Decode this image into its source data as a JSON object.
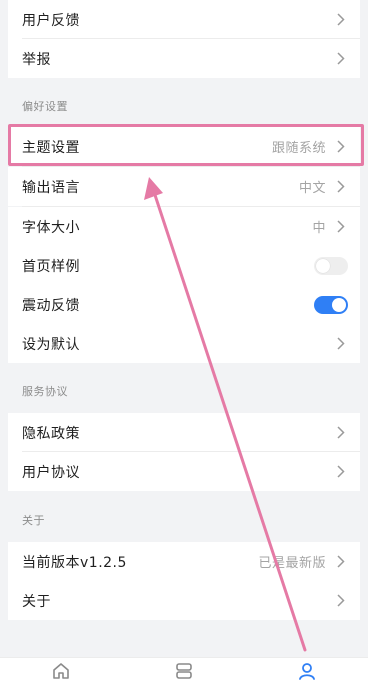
{
  "colors": {
    "background": "#f2f3f5",
    "card": "#ffffff",
    "toggle_on": "#2f7ff5",
    "highlight": "#e57aa5"
  },
  "rows": {
    "feedback": "用户反馈",
    "report": "举报",
    "theme": {
      "label": "主题设置",
      "value": "跟随系统"
    },
    "language": {
      "label": "输出语言",
      "value": "中文"
    },
    "font_size": {
      "label": "字体大小",
      "value": "中"
    },
    "home_style": {
      "label": "首页样例",
      "toggle": false
    },
    "vibration": {
      "label": "震动反馈",
      "toggle": true
    },
    "set_default": "设为默认",
    "privacy": "隐私政策",
    "user_agreement": "用户协议",
    "version": {
      "label": "当前版本v1.2.5",
      "value": "已是最新版"
    },
    "about": "关于"
  },
  "sections": {
    "preferences": "偏好设置",
    "service": "服务协议",
    "about": "关于"
  },
  "tabbar": {
    "tabs": [
      {
        "icon": "home-icon"
      },
      {
        "icon": "layers-icon"
      },
      {
        "icon": "person-icon",
        "active": true
      }
    ]
  }
}
